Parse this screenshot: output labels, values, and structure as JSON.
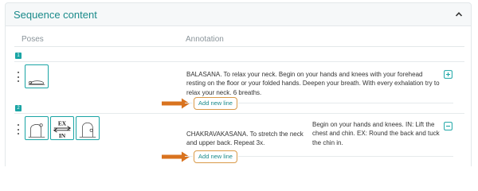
{
  "header": {
    "title": "Sequence content"
  },
  "columns": {
    "poses": "Poses",
    "annotation": "Annotation"
  },
  "rows": [
    {
      "index": "1",
      "annotation": "BALASANA. To relax your neck. Begin on your hands and knees with your forehead resting on the floor or your folded hands. Deepen your breath. With every exhalation try to relax your neck. 6 breaths.",
      "add_label": "Add new line",
      "control": "plus-square-icon"
    },
    {
      "index": "2",
      "annotation_left": "CHAKRAVAKASANA. To stretch the neck and upper back. Repeat 3x.",
      "annotation_right": "Begin on your hands and knees. IN: Lift the chest and chin. EX: Round the back and tuck the chin in.",
      "ex_label": "EX",
      "in_label": "IN",
      "add_label": "Add new line",
      "control": "minus-square-icon"
    }
  ],
  "colors": {
    "accent": "#1aa5a5",
    "title": "#1a8a8a",
    "arrow": "#d9731f",
    "button_border": "#d99a48"
  }
}
